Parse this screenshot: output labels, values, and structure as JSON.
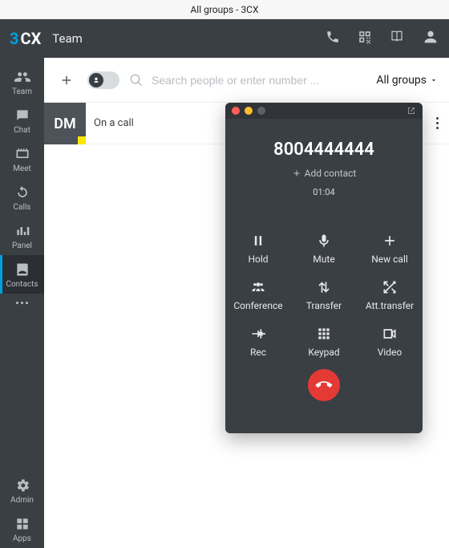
{
  "window": {
    "title": "All groups - 3CX"
  },
  "header": {
    "logo_part1": "3",
    "logo_part2": "CX",
    "title": "Team"
  },
  "sidebar": {
    "items": [
      {
        "label": "Team"
      },
      {
        "label": "Chat"
      },
      {
        "label": "Meet"
      },
      {
        "label": "Calls"
      },
      {
        "label": "Panel"
      },
      {
        "label": "Contacts"
      }
    ],
    "admin_label": "Admin",
    "apps_label": "Apps"
  },
  "toolbar": {
    "search_placeholder": "Search people or enter number ...",
    "groups_label": "All groups"
  },
  "contact_row": {
    "initials": "DM",
    "status": "On a call"
  },
  "call": {
    "number": "8004444444",
    "add_contact": "Add contact",
    "duration": "01:04",
    "buttons": {
      "hold": "Hold",
      "mute": "Mute",
      "new_call": "New call",
      "conference": "Conference",
      "transfer": "Transfer",
      "att_transfer": "Att.transfer",
      "rec": "Rec",
      "keypad": "Keypad",
      "video": "Video"
    }
  }
}
